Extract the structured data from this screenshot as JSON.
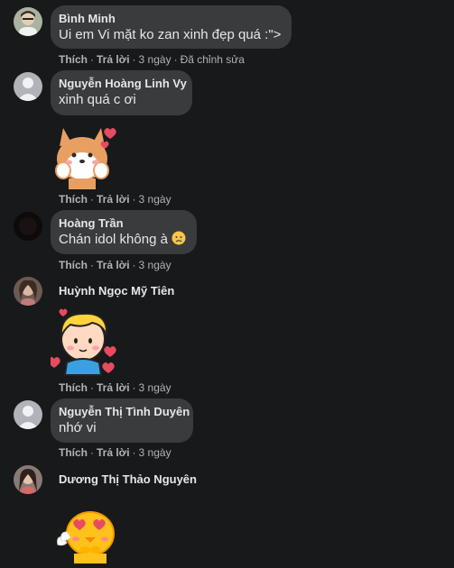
{
  "comments": [
    {
      "name": "Bình Minh",
      "text": "Ui em Vi mặt ko zan xinh đẹp quá :\">",
      "like": "Thích",
      "reply": "Trả lời",
      "time": "3 ngày",
      "edited": "Đã chỉnh sửa"
    },
    {
      "name": "Nguyễn Hoàng Linh Vy",
      "text": "xinh quá c ơi",
      "like": "Thích",
      "reply": "Trả lời",
      "time": "3 ngày",
      "sticker": "shiba-dog-blushing-sticker"
    },
    {
      "name": "Hoàng Trần",
      "text": "Chán idol không à",
      "emoji": "sad-crying-face-emoji",
      "like": "Thích",
      "reply": "Trả lời",
      "time": "3 ngày"
    },
    {
      "name": "Huỳnh Ngọc Mỹ Tiên",
      "like": "Thích",
      "reply": "Trả lời",
      "time": "3 ngày",
      "sticker": "blond-boy-hearts-sticker"
    },
    {
      "name": "Nguyễn Thị Tình Duyên",
      "text": "nhớ vi",
      "like": "Thích",
      "reply": "Trả lời",
      "time": "3 ngày"
    },
    {
      "name": "Dương Thị Thảo Nguyên",
      "sticker": "yellow-chick-heart-eyes-sticker"
    }
  ],
  "colors": {
    "background": "#18191a",
    "bubble": "#3a3b3c",
    "primary_text": "#e4e6eb",
    "secondary_text": "#b0b3b8"
  }
}
